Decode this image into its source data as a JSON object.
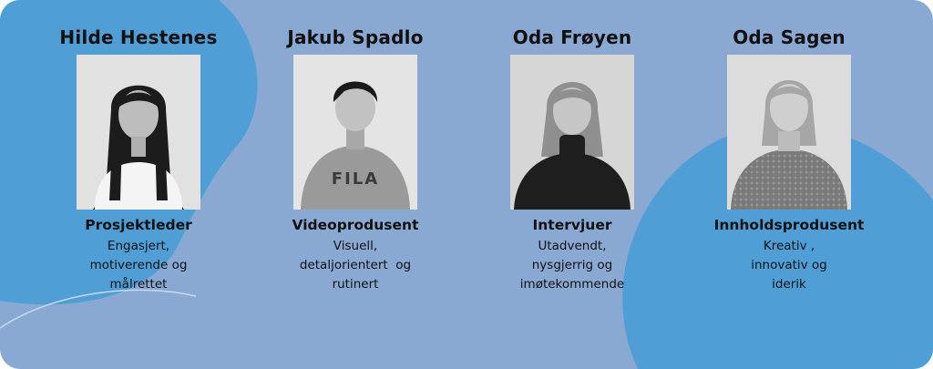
{
  "team": [
    {
      "name": "Hilde Hestenes",
      "role": "Prosjektleder",
      "description": [
        "Engasjert,",
        "motiverende og",
        "målrettet"
      ]
    },
    {
      "name": "Jakub Spadlo",
      "role": "Videoprodusent",
      "description": [
        "Visuell,",
        "detaljorientert  og",
        "rutinert"
      ]
    },
    {
      "name": "Oda Frøyen",
      "role": "Intervjuer",
      "description": [
        "Utadvendt,",
        "nysgjerrig og",
        "imøtekommende"
      ]
    },
    {
      "name": "Oda Sagen",
      "role": "Innholdsprodusent",
      "description": [
        "Kreativ ,",
        "innovativ og",
        "iderik"
      ]
    }
  ],
  "colors": {
    "background": "#89a9d3",
    "blob": "#4f9fd6",
    "text": "#111111"
  }
}
